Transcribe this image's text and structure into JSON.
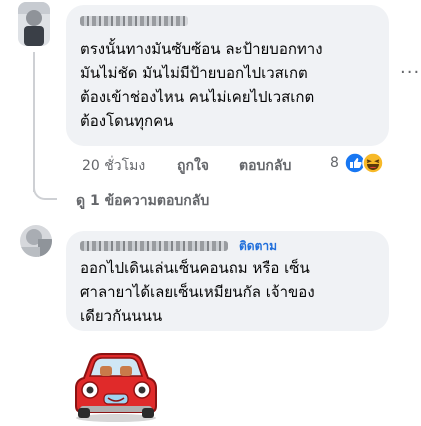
{
  "comments": [
    {
      "text": "ตรงนั้นทางมันซับซ้อน ละป้ายบอกทาง\nมันไม่ชัด มันไม่มีป้ายบอกไปเวสเกต\nต้องเข้าช่องไหน คนไม่เคยไปเวสเกต\nต้องโดนทุกคน",
      "time": "20 ชั่วโมง",
      "like": "ถูกใจ",
      "reply": "ตอบกลับ",
      "reaction_count": "8",
      "reactions": [
        "like-icon",
        "haha-icon"
      ],
      "more_icon": "more-options-icon"
    },
    {
      "follow_label": "ติดตาม",
      "text": "ออกไปเดินเล่นเซ็นคอนถม หรือ เซ็น\nศาลายาได้เลยเซ็นเหมียนกัล เจ้าของ\nเดียวกันนนน",
      "sticker": "red-car-sticker"
    }
  ],
  "replies_link": "ดู 1 ข้อความตอบกลับ",
  "colors": {
    "bubble": "#f0f2f5",
    "meta": "#65676b",
    "link": "#216fdb",
    "like_blue": "#1877f2",
    "haha_yellow": "#f7b928"
  }
}
